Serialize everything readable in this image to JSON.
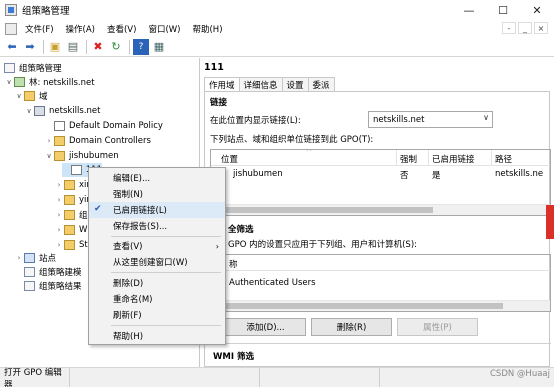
{
  "window": {
    "title": "组策略管理",
    "controls": [
      "—",
      "☐",
      "✕"
    ]
  },
  "menubar": {
    "items": [
      "文件(F)",
      "操作(A)",
      "查看(V)",
      "窗口(W)",
      "帮助(H)"
    ],
    "mdi_controls": [
      "-",
      "_",
      "×"
    ]
  },
  "toolbar": {
    "icons": [
      "back-icon",
      "forward-icon",
      "folder-up-icon",
      "show-hide-tree-icon",
      "delete-icon",
      "refresh-icon",
      "help-icon",
      "properties-icon"
    ]
  },
  "tree": {
    "nodes": [
      {
        "label": "组策略管理",
        "icon": "gpo-icon",
        "expanded": true
      },
      {
        "label": "林: netskills.net",
        "icon": "forest-icon",
        "expanded": true
      },
      {
        "label": "域",
        "icon": "folder-icon",
        "expanded": true
      },
      {
        "label": "netskills.net",
        "icon": "domain-icon",
        "expanded": true
      },
      {
        "label": "Default Domain Policy",
        "icon": "gpo-link-icon"
      },
      {
        "label": "Domain Controllers",
        "icon": "ou-icon"
      },
      {
        "label": "jishubumen",
        "icon": "ou-icon",
        "expanded": true
      },
      {
        "label": "111",
        "icon": "gpo-link-icon",
        "selected": true
      },
      {
        "label": "xin",
        "icon": "ou-icon"
      },
      {
        "label": "yin",
        "icon": "ou-icon"
      },
      {
        "label": "组",
        "icon": "ou-icon"
      },
      {
        "label": "WM",
        "icon": "ou-icon"
      },
      {
        "label": "Sta",
        "icon": "ou-icon"
      },
      {
        "label": "站点",
        "icon": "sites-icon"
      },
      {
        "label": "组策略建模",
        "icon": "modeling-icon"
      },
      {
        "label": "组策略结果",
        "icon": "results-icon"
      }
    ]
  },
  "right": {
    "title": "111",
    "tabs": [
      "作用域",
      "详细信息",
      "设置",
      "委派"
    ],
    "links_heading": "链接",
    "location_label": "在此位置内显示链接(L):",
    "location_value": "netskills.net",
    "links_list_label": "下列站点、域和组织单位链接到此 GPO(T):",
    "columns": [
      "位置",
      "强制",
      "已启用链接",
      "路径"
    ],
    "rows": [
      {
        "location": "jishubumen",
        "enforced": "否",
        "enabled": "是",
        "path": "netskills.ne"
      }
    ],
    "filter_heading": "全筛选",
    "filter_label": "GPO 内的设置只应用于下列组、用户和计算机(S):",
    "filter_column": "称",
    "filter_rows": [
      "Authenticated Users"
    ],
    "buttons": {
      "add": "添加(D)...",
      "remove": "删除(R)",
      "properties": "属性(P)"
    },
    "wmi_heading": "WMI 筛选"
  },
  "context_menu": {
    "items": [
      {
        "label": "编辑(E)..."
      },
      {
        "label": "强制(N)"
      },
      {
        "label": "已启用链接(L)",
        "checked": true
      },
      {
        "label": "保存报告(S)..."
      },
      {
        "label": "查看(V)",
        "submenu": true
      },
      {
        "label": "从这里创建窗口(W)"
      },
      {
        "label": "删除(D)"
      },
      {
        "label": "重命名(M)"
      },
      {
        "label": "刷新(F)"
      },
      {
        "label": "帮助(H)"
      }
    ]
  },
  "status": {
    "text": "打开 GPO 编辑器",
    "watermark": "CSDN @Huaaj"
  },
  "colors": {
    "selection": "#cce4f7",
    "accent_red": "#d9302a"
  }
}
